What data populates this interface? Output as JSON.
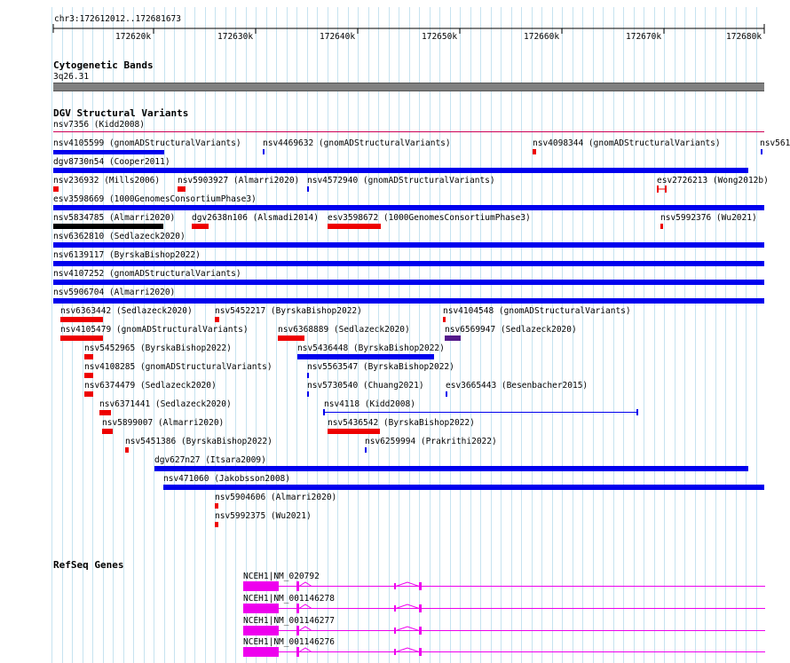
{
  "ruler": {
    "location": "chr3:172612012..172681673",
    "ticks": [
      "172620k",
      "172630k",
      "172640k",
      "172650k",
      "172660k",
      "172670k",
      "172680k"
    ]
  },
  "cytoband": {
    "title": "Cytogenetic Bands",
    "band": "3q26.31"
  },
  "dgv": {
    "title": "DGV Structural Variants",
    "top_label": "nsv7356 (Kidd2008)",
    "features": [
      {
        "label": "nsv4105599 (gnomADStructuralVariants)",
        "color": "#0000ee"
      },
      {
        "label": "nsv4469632 (gnomADStructuralVariants)",
        "color": "#0000ee"
      },
      {
        "label": "nsv4098344 (gnomADStructuralVariants)",
        "color": "#ee0000"
      },
      {
        "label": "nsv561",
        "color": "#0000ee"
      },
      {
        "label": "dgv8730n54 (Cooper2011)",
        "color": "#0000ee"
      },
      {
        "label": "nsv236932 (Mills2006)",
        "color": "#ee0000"
      },
      {
        "label": "nsv5903927 (Almarri2020)",
        "color": "#ee0000"
      },
      {
        "label": "nsv4572940 (gnomADStructuralVariants)",
        "color": "#0000ee"
      },
      {
        "label": "esv2726213 (Wong2012b)",
        "color": "#ee0000"
      },
      {
        "label": "esv3598669 (1000GenomesConsortiumPhase3)",
        "color": "#0000ee"
      },
      {
        "label": "nsv5834785 (Almarri2020)",
        "color": "#000000"
      },
      {
        "label": "dgv2638n106 (Alsmadi2014)",
        "color": "#ee0000"
      },
      {
        "label": "esv3598672 (1000GenomesConsortiumPhase3)",
        "color": "#ee0000"
      },
      {
        "label": "nsv5992376 (Wu2021)",
        "color": "#ee0000"
      },
      {
        "label": "nsv6362810 (Sedlazeck2020)",
        "color": "#0000ee"
      },
      {
        "label": "nsv6139117 (ByrskaBishop2022)",
        "color": "#0000ee"
      },
      {
        "label": "nsv4107252 (gnomADStructuralVariants)",
        "color": "#0000ee"
      },
      {
        "label": "nsv5906704 (Almarri2020)",
        "color": "#0000ee"
      },
      {
        "label": "nsv6363442 (Sedlazeck2020)",
        "color": "#ee0000"
      },
      {
        "label": "nsv5452217 (ByrskaBishop2022)",
        "color": "#ee0000"
      },
      {
        "label": "nsv4104548 (gnomADStructuralVariants)",
        "color": "#ee0000"
      },
      {
        "label": "nsv4105479 (gnomADStructuralVariants)",
        "color": "#ee0000"
      },
      {
        "label": "nsv6368889 (Sedlazeck2020)",
        "color": "#ee0000"
      },
      {
        "label": "nsv6569947 (Sedlazeck2020)",
        "color": "#551a8b"
      },
      {
        "label": "nsv5452965 (ByrskaBishop2022)",
        "color": "#ee0000"
      },
      {
        "label": "nsv5436448 (ByrskaBishop2022)",
        "color": "#0000ee"
      },
      {
        "label": "nsv4108285 (gnomADStructuralVariants)",
        "color": "#ee0000"
      },
      {
        "label": "nsv5563547 (ByrskaBishop2022)",
        "color": "#0000ee"
      },
      {
        "label": "nsv6374479 (Sedlazeck2020)",
        "color": "#ee0000"
      },
      {
        "label": "nsv5730540 (Chuang2021)",
        "color": "#0000ee"
      },
      {
        "label": "esv3665443 (Besenbacher2015)",
        "color": "#0000ee"
      },
      {
        "label": "nsv6371441 (Sedlazeck2020)",
        "color": "#ee0000"
      },
      {
        "label": "nsv4118 (Kidd2008)",
        "color": "#0000ee"
      },
      {
        "label": "nsv5899007 (Almarri2020)",
        "color": "#ee0000"
      },
      {
        "label": "nsv5436542 (ByrskaBishop2022)",
        "color": "#ee0000"
      },
      {
        "label": "nsv5451386 (ByrskaBishop2022)",
        "color": "#ee0000"
      },
      {
        "label": "nsv6259994 (Prakrithi2022)",
        "color": "#0000ee"
      },
      {
        "label": "dgv627n27 (Itsara2009)",
        "color": "#0000ee"
      },
      {
        "label": "nsv471060 (Jakobsson2008)",
        "color": "#0000ee"
      },
      {
        "label": "nsv5904606 (Almarri2020)",
        "color": "#ee0000"
      },
      {
        "label": "nsv5992375 (Wu2021)",
        "color": "#ee0000"
      }
    ]
  },
  "refseq": {
    "title": "RefSeq Genes",
    "color": "#ee00ee",
    "transcripts": [
      {
        "label": "NCEH1|NM_020792"
      },
      {
        "label": "NCEH1|NM_001146278"
      },
      {
        "label": "NCEH1|NM_001146277"
      },
      {
        "label": "NCEH1|NM_001146276"
      }
    ]
  }
}
